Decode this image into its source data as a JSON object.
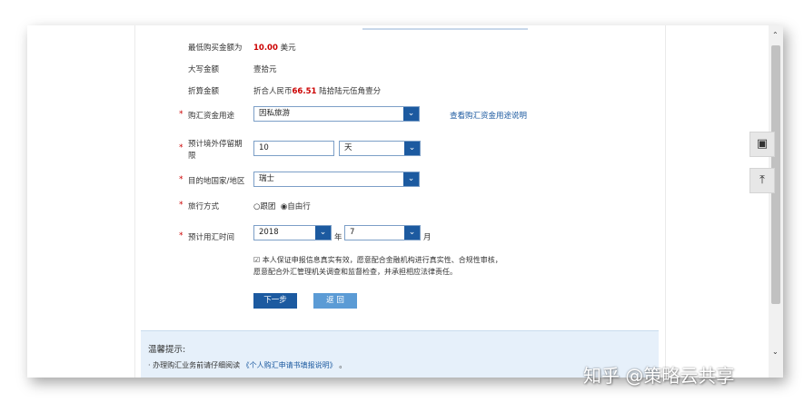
{
  "form": {
    "min_amount": {
      "label": "最低购买金额为",
      "value": "10.00",
      "unit": "美元"
    },
    "uppercase_amount": {
      "label": "大写金额",
      "value": "壹拾元"
    },
    "converted_amount": {
      "label": "折算金额",
      "prefix": "折合人民币",
      "value": "66.51",
      "suffix": "陆拾陆元伍角壹分"
    },
    "purpose": {
      "required": "*",
      "label": "购汇资金用途",
      "value": "因私旅游",
      "help_link": "查看购汇资金用途说明"
    },
    "stay_period": {
      "required": "*",
      "label_line1": "预计境外停留期",
      "label_line2": "限",
      "value": "10",
      "unit_value": "天"
    },
    "destination": {
      "required": "*",
      "label": "目的地国家/地区",
      "value": "瑞士"
    },
    "travel_mode": {
      "required": "*",
      "label": "旅行方式",
      "options": [
        "跟团",
        "自由行"
      ],
      "selected": "自由行"
    },
    "usage_time": {
      "required": "*",
      "label": "预计用汇时间",
      "year": "2018",
      "year_unit": "年",
      "month": "7",
      "month_unit": "月"
    },
    "agreement": {
      "checked": true,
      "line1": "本人保证申报信息真实有效，愿意配合金融机构进行真实性、合规性审核，",
      "line2": "愿意配合外汇管理机关调查和监督检查，并承担相应法律责任。"
    },
    "next_button": "下一步",
    "back_button": "返 回"
  },
  "tips": {
    "title": "温馨提示:",
    "item1_prefix": "办理购汇业务前请仔细阅读",
    "item1_link": "《个人购汇申请书填报说明》",
    "item1_suffix": "。"
  },
  "side_buttons": {
    "contact_icon": "contact-card-icon",
    "top_icon": "back-to-top-icon"
  },
  "watermark": "知乎 @策略云共享",
  "colors": {
    "accent": "#1c5aa0",
    "button": "#1c5aa0",
    "button_light": "#5b9bd5",
    "highlight": "#cc0000"
  }
}
